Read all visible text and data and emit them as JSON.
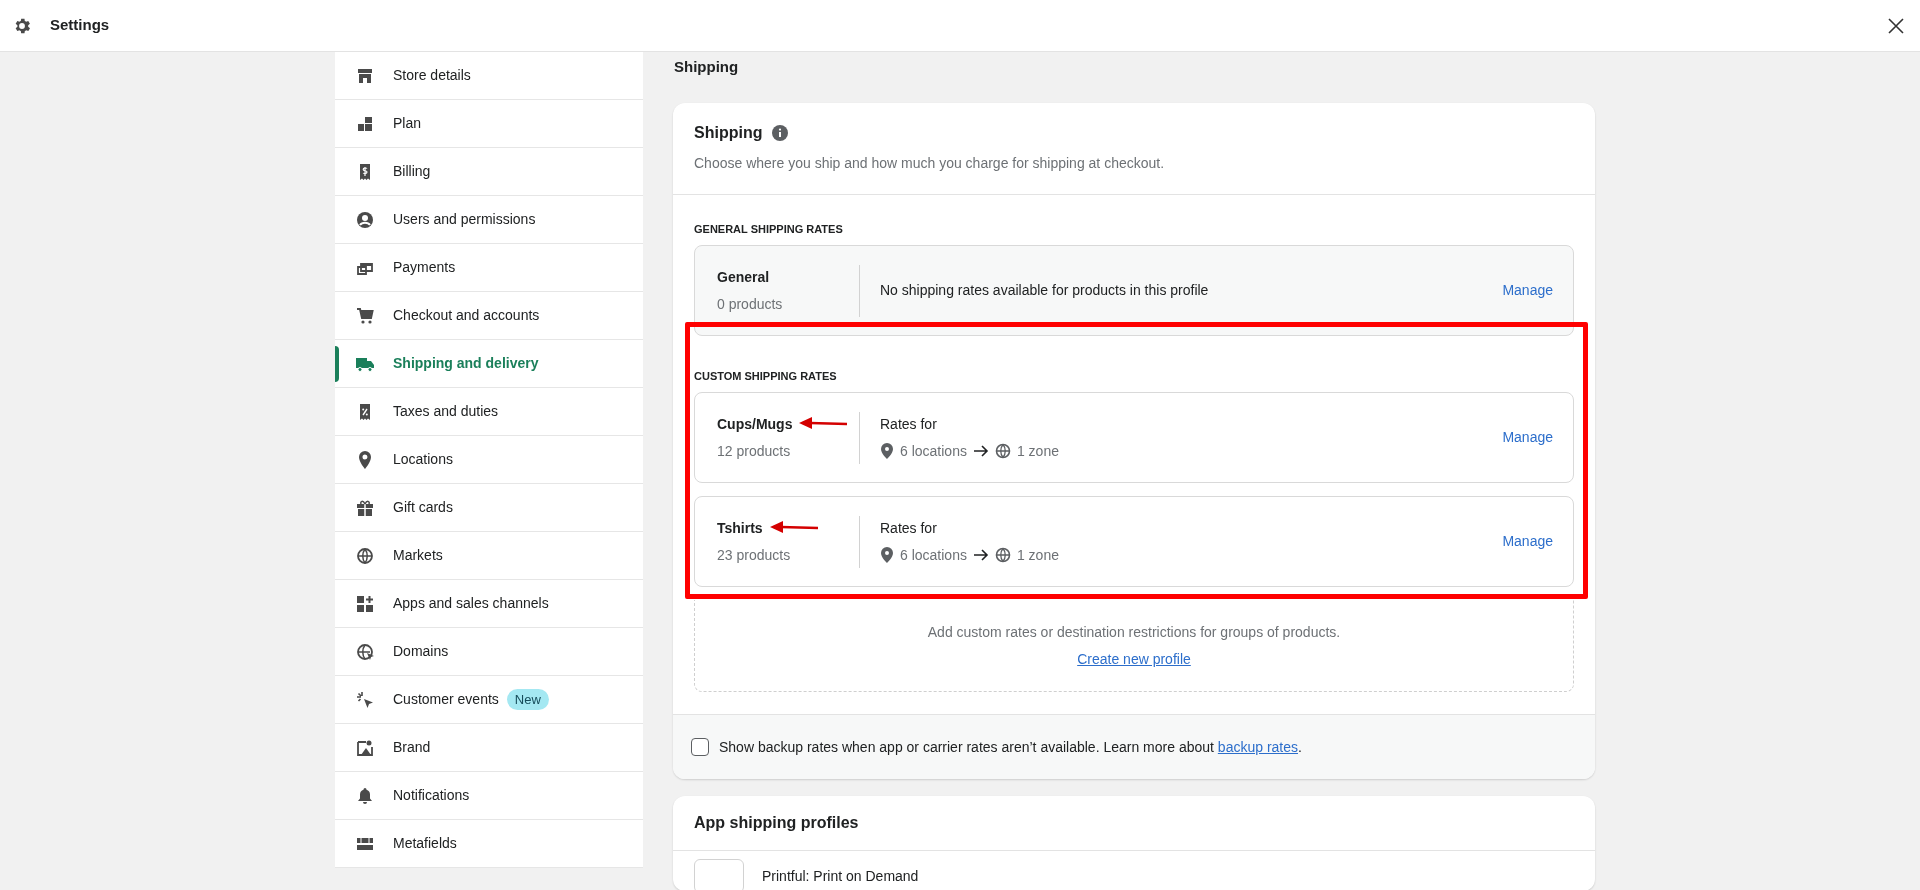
{
  "header": {
    "title": "Settings"
  },
  "sidebar": {
    "items": [
      {
        "label": "Store details",
        "selected": false
      },
      {
        "label": "Plan",
        "selected": false
      },
      {
        "label": "Billing",
        "selected": false
      },
      {
        "label": "Users and permissions",
        "selected": false
      },
      {
        "label": "Payments",
        "selected": false
      },
      {
        "label": "Checkout and accounts",
        "selected": false
      },
      {
        "label": "Shipping and delivery",
        "selected": true
      },
      {
        "label": "Taxes and duties",
        "selected": false
      },
      {
        "label": "Locations",
        "selected": false
      },
      {
        "label": "Gift cards",
        "selected": false
      },
      {
        "label": "Markets",
        "selected": false
      },
      {
        "label": "Apps and sales channels",
        "selected": false
      },
      {
        "label": "Domains",
        "selected": false
      },
      {
        "label": "Customer events",
        "badge": "New",
        "selected": false
      },
      {
        "label": "Brand",
        "selected": false
      },
      {
        "label": "Notifications",
        "selected": false
      },
      {
        "label": "Metafields",
        "selected": false
      }
    ]
  },
  "page_title": "Shipping",
  "shipping_card": {
    "title": "Shipping",
    "description": "Choose where you ship and how much you charge for shipping at checkout.",
    "general": {
      "heading": "GENERAL SHIPPING RATES",
      "profiles": [
        {
          "kind": "empty",
          "name": "General",
          "count": "0 products",
          "summary": "No shipping rates available for products in this profile",
          "action": "Manage"
        }
      ]
    },
    "custom": {
      "heading": "CUSTOM SHIPPING RATES",
      "highlighted": true,
      "profiles": [
        {
          "kind": "rates",
          "name": "Cups/Mugs",
          "count": "12 products",
          "rates_label": "Rates for",
          "locations": "6 locations",
          "zones": "1 zone",
          "action": "Manage",
          "annotated": true
        },
        {
          "kind": "rates",
          "name": "Tshirts",
          "count": "23 products",
          "rates_label": "Rates for",
          "locations": "6 locations",
          "zones": "1 zone",
          "action": "Manage",
          "annotated": true
        }
      ]
    },
    "create": {
      "text": "Add custom rates or destination restrictions for groups of products.",
      "link": "Create new profile"
    },
    "backup": {
      "checked": false,
      "text": "Show backup rates when app or carrier rates aren’t available. Learn more about ",
      "link": "backup rates",
      "suffix": "."
    }
  },
  "app_profiles": {
    "title": "App shipping profiles",
    "items": [
      {
        "name": "Printful: Print on Demand"
      }
    ]
  }
}
